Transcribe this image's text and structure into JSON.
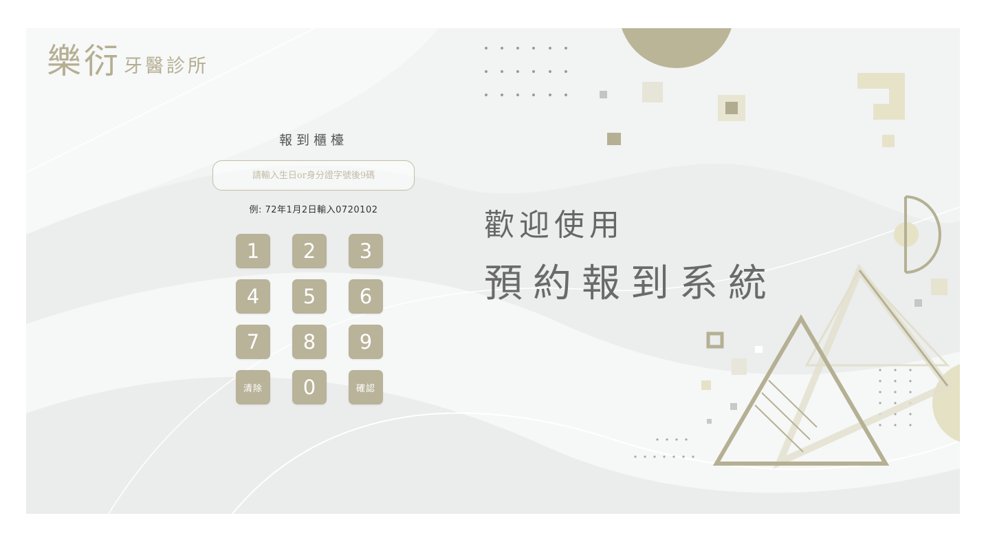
{
  "logo": {
    "main": "樂衍",
    "sub": "牙醫診所"
  },
  "panel": {
    "title": "報到櫃檯",
    "input_placeholder": "請輸入生日or身分證字號後9碼",
    "input_value": "",
    "example": "例: 72年1月2日輸入0720102"
  },
  "keypad": {
    "keys": [
      "1",
      "2",
      "3",
      "4",
      "5",
      "6",
      "7",
      "8",
      "9"
    ],
    "clear_label": "清除",
    "zero_label": "0",
    "confirm_label": "確認"
  },
  "welcome": {
    "line1": "歡迎使用",
    "line2": "預約報到系統"
  },
  "colors": {
    "accent": "#b8b399",
    "decor_light": "#e6e3cf",
    "decor_gray": "#c0c0c0",
    "text_dark": "#666666",
    "background": "#f2f3f3"
  }
}
